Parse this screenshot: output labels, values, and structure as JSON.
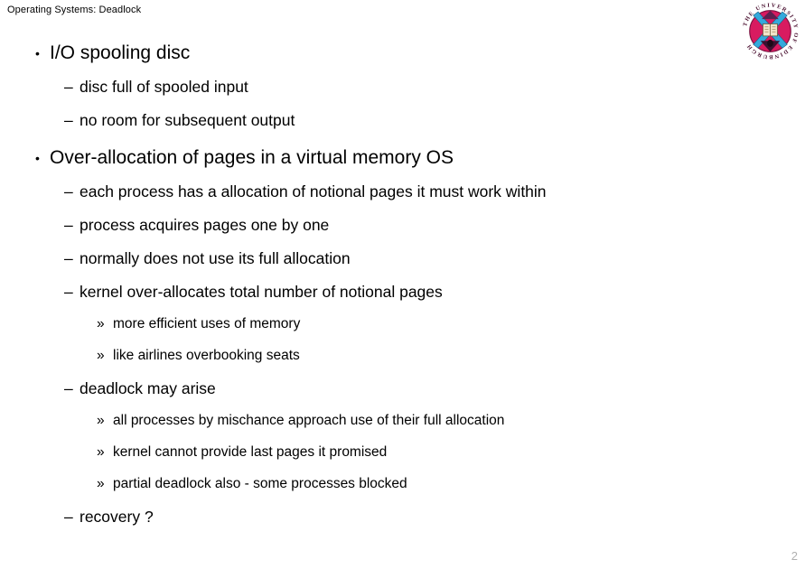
{
  "header": {
    "title": "Operating Systems: Deadlock"
  },
  "logo": {
    "name": "university-of-edinburgh-crest",
    "ring_text": "THE UNIVERSITY OF EDINBURGH",
    "colors": {
      "ring": "#C2185B",
      "disc": "#D81B60",
      "saltire": "#34A9DC",
      "book": "#F2E4C9",
      "outline": "#6A1B4D"
    }
  },
  "markers": {
    "level1": "•",
    "level2": "–",
    "level3": "»"
  },
  "body": {
    "lines": [
      {
        "level": 1,
        "text": "I/O spooling disc"
      },
      {
        "level": 2,
        "text": "disc full of spooled input"
      },
      {
        "level": 2,
        "text": "no room for subsequent output"
      },
      {
        "level": 1,
        "text": "Over-allocation of pages in a virtual memory OS"
      },
      {
        "level": 2,
        "text": "each process has a allocation of notional pages it must work within"
      },
      {
        "level": 2,
        "text": "process acquires pages one by one"
      },
      {
        "level": 2,
        "text": "normally does not use its full allocation"
      },
      {
        "level": 2,
        "text": "kernel over-allocates total number of notional pages"
      },
      {
        "level": 3,
        "text": "more efficient uses of memory"
      },
      {
        "level": 3,
        "text": "like airlines overbooking seats"
      },
      {
        "level": 2,
        "text": "deadlock may arise"
      },
      {
        "level": 3,
        "text": "all processes by mischance approach use of their full allocation"
      },
      {
        "level": 3,
        "text": "kernel cannot provide last pages it promised"
      },
      {
        "level": 3,
        "text": "partial deadlock also - some processes blocked"
      },
      {
        "level": 2,
        "text": "recovery ?"
      }
    ]
  },
  "footer": {
    "page_number": "2"
  }
}
